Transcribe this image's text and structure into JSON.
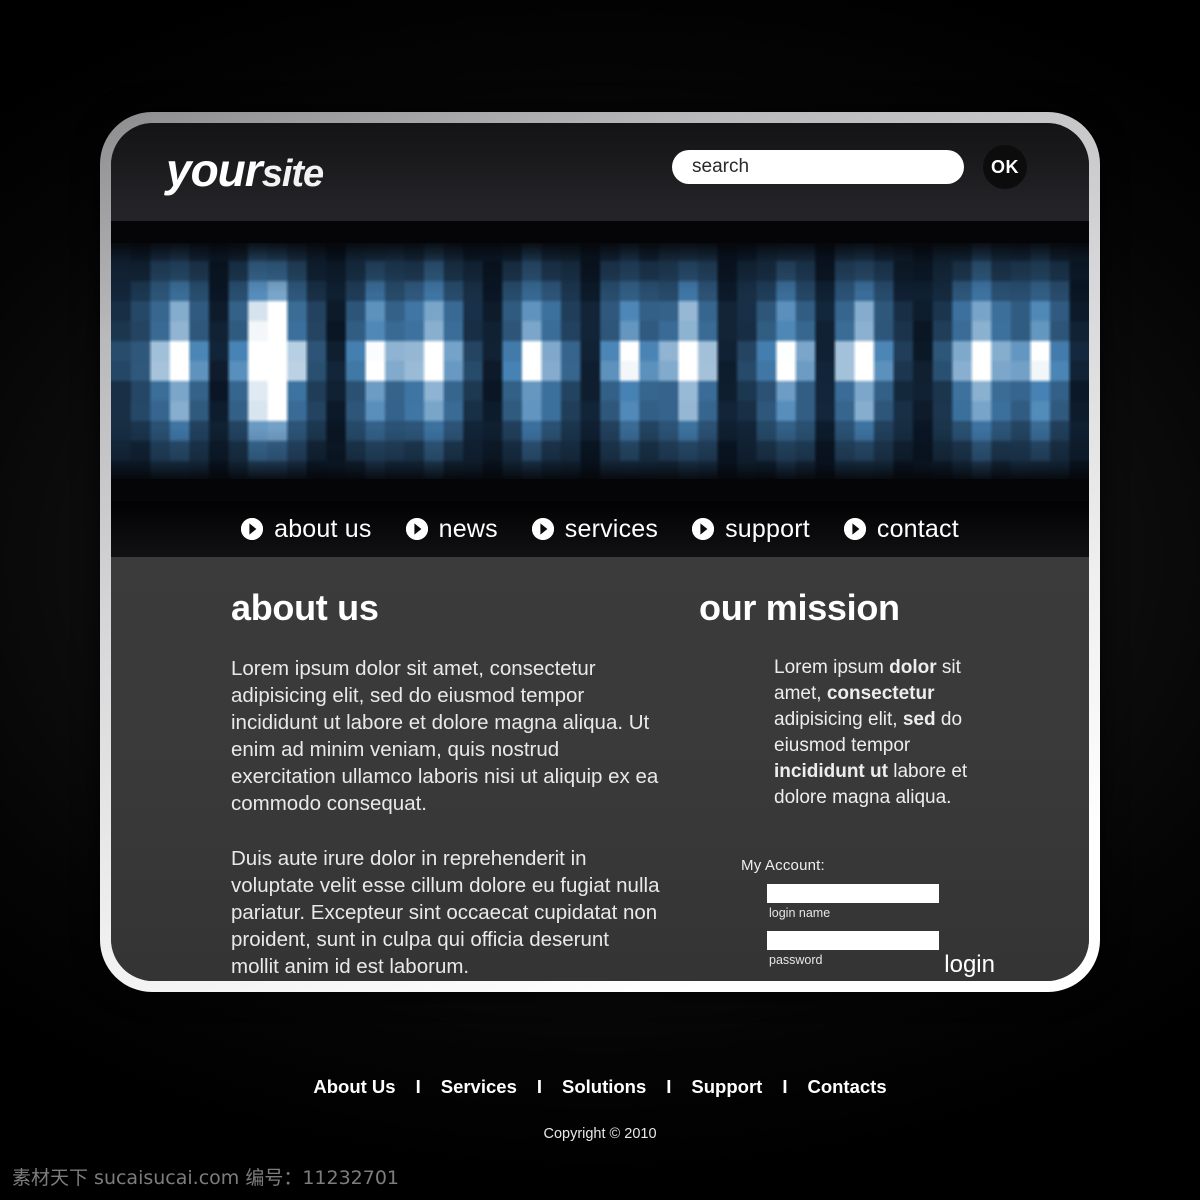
{
  "header": {
    "logo_primary": "your",
    "logo_secondary": "site",
    "search_placeholder": "search",
    "search_value": "",
    "ok_label": "OK"
  },
  "nav": {
    "items": [
      {
        "label": "about us",
        "icon": "play-circle-icon"
      },
      {
        "label": "news",
        "icon": "play-circle-icon"
      },
      {
        "label": "services",
        "icon": "play-circle-icon"
      },
      {
        "label": "support",
        "icon": "play-circle-icon"
      },
      {
        "label": "contact",
        "icon": "play-circle-icon"
      }
    ]
  },
  "about": {
    "title": "about us",
    "paragraph_1": "Lorem ipsum dolor sit amet, consectetur adipisicing elit, sed do eiusmod tempor incididunt ut labore et dolore magna aliqua. Ut enim ad minim veniam, quis nostrud exercitation ullamco laboris nisi ut aliquip ex ea commodo consequat.",
    "paragraph_2": "Duis aute irure dolor in reprehenderit in voluptate velit esse cillum dolore eu fugiat nulla pariatur. Excepteur sint occaecat cupidatat non proident, sunt in culpa qui officia deserunt mollit anim id est laborum."
  },
  "mission": {
    "title": "our mission",
    "paragraph": "Lorem ipsum dolor sit amet, consectetur adipisicing elit, sed do eiusmod tempor incididunt ut labore et dolore magna aliqua."
  },
  "login": {
    "account_label": "My Account:",
    "login_name_value": "",
    "login_name_caption": "login name",
    "password_value": "",
    "password_caption": "password",
    "login_button_label": "login"
  },
  "footer": {
    "links": [
      "About Us",
      "Services",
      "Solutions",
      "Support",
      "Contacts"
    ],
    "separator": "I",
    "copyright": "Copyright © 2010"
  },
  "watermark": {
    "text": "素材天下 sucaisucai.com 编号：11232701"
  },
  "colors": {
    "frame": "#ffffff",
    "header_bg": "#1a1a1c",
    "nav_bg": "#0a0a0c",
    "content_bg": "#3a3a3a",
    "page_bg": "#000000",
    "banner_accent": "#5aa8e0",
    "banner_highlight": "#ffffff",
    "text_primary": "#ffffff"
  },
  "banner": {
    "style": "pixelated-blue-equalizer",
    "description": "mosaic of blue vertical and horizontal bands with white highlights"
  }
}
